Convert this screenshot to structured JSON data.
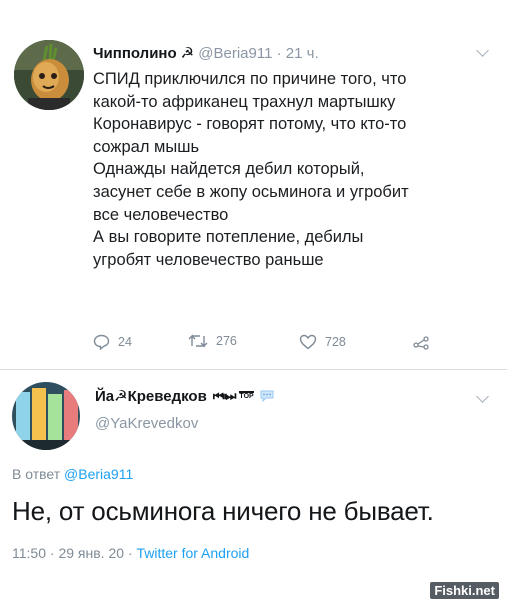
{
  "tweet1": {
    "author_name": "Чипполино",
    "author_emblem": "☭",
    "handle": "@Beria911",
    "separator": "·",
    "time": "21 ч.",
    "lines": [
      "СПИД приключился  по причине того, что",
      "какой-то африканец трахнул мартышку",
      "Коронавирус - говорят потому, что кто-то",
      "сожрал мышь",
      "Однажды найдется дебил который,",
      "засунет себе в жопу осьминога и угробит",
      "все человечество",
      "А вы говорите потепление, дебилы",
      "угробят человечество раньше"
    ],
    "actions": {
      "replies": "24",
      "retweets": "276",
      "likes": "728"
    }
  },
  "tweet2": {
    "author_name": "Йа☭Креведков",
    "name_decor": "⏮⏸⏭",
    "top_badge": "TOP",
    "handle": "@YaKrevedkov",
    "reply_prefix": "В ответ",
    "reply_mention": "@Beria911",
    "text": "Не, от осьминога ничего не бывает.",
    "time": "11:50",
    "date": "29 янв. 20",
    "separator": "·",
    "source": "Twitter for Android"
  },
  "watermark": "Fishki.net",
  "colors": {
    "accent": "#1da1f2",
    "muted": "#7f8b96",
    "text": "#14171a"
  }
}
